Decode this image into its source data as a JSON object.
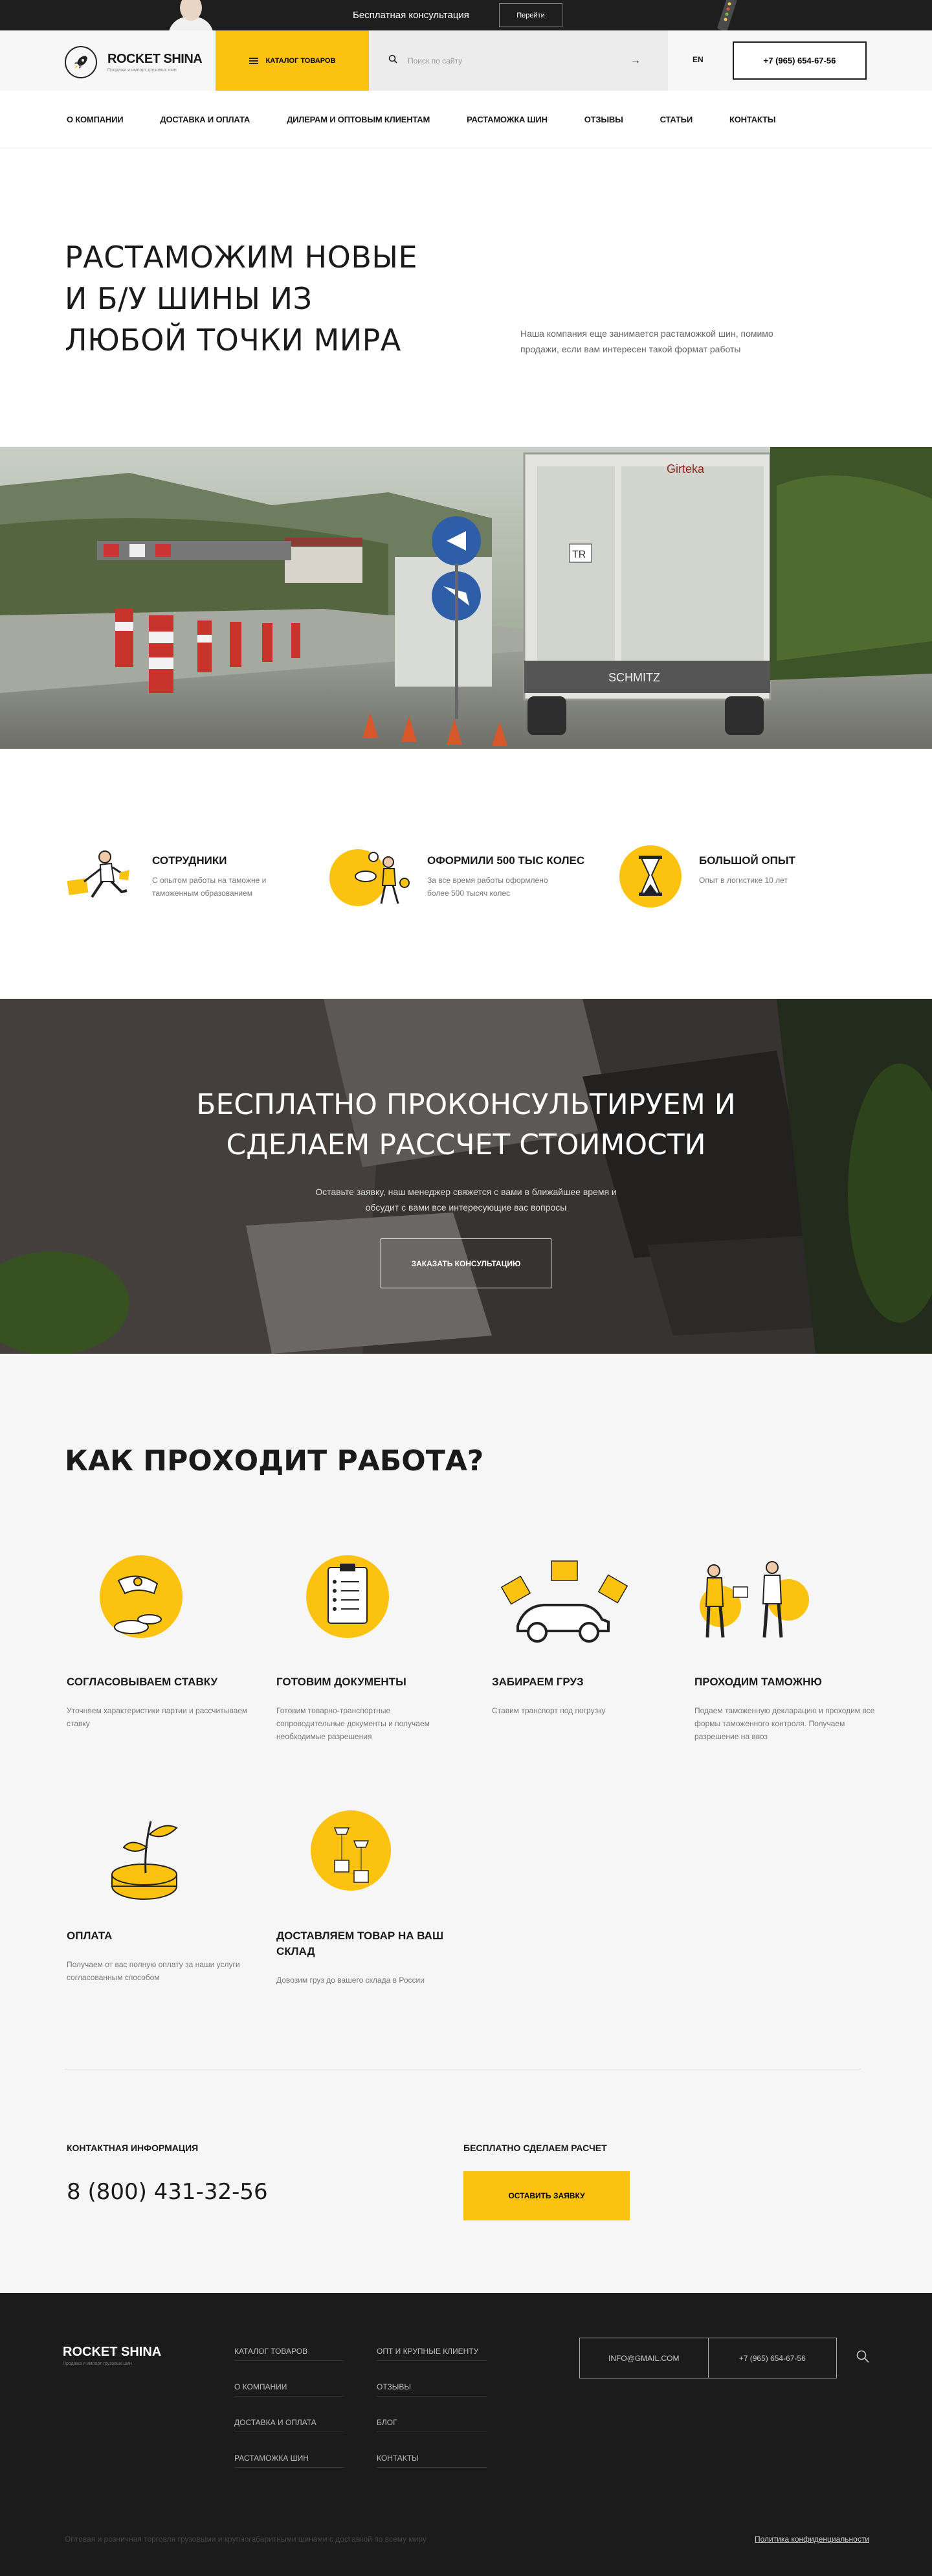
{
  "promo": {
    "text": "Бесплатная консультация",
    "button": "Перейти"
  },
  "header": {
    "logo_name": "ROCKET SHINA",
    "logo_sub": "Продажа и импорт грузовых шин",
    "catalog": "КАТАЛОГ ТОВАРОВ",
    "search_placeholder": "Поиск по сайту",
    "lang": "EN",
    "phone": "+7 (965) 654-67-56"
  },
  "nav": [
    "О КОМПАНИИ",
    "ДОСТАВКА И ОПЛАТА",
    "ДИЛЕРАМ И ОПТОВЫМ КЛИЕНТАМ",
    "РАСТАМОЖКА ШИН",
    "ОТЗЫВЫ",
    "СТАТЬИ",
    "КОНТАКТЫ"
  ],
  "hero": {
    "title": "РАСТАМОЖИМ НОВЫЕ И Б/У ШИНЫ ИЗ ЛЮБОЙ ТОЧКИ МИРА",
    "description": "Наша компания еще занимается растаможкой шин, помимо продажи, если вам интересен такой формат работы"
  },
  "photo": {
    "trailer_brand": "SCHMITZ",
    "plate": "TR",
    "company": "Girteka"
  },
  "stats": [
    {
      "title": "СОТРУДНИКИ",
      "desc": "С опытом работы на таможне и таможенным образованием"
    },
    {
      "title": "ОФОРМИЛИ 500 ТЫС КОЛЕС",
      "desc": "За все время работы оформлено более 500 тысяч колес"
    },
    {
      "title": "БОЛЬШОЙ ОПЫТ",
      "desc": "Опыт в логистике 10 лет"
    }
  ],
  "consult": {
    "title_line1": "БЕСПЛАТНО ПРОКОНСУЛЬТИРУЕМ И",
    "title_line2": "СДЕЛАЕМ РАССЧЕТ СТОИМОСТИ",
    "desc": "Оставьте заявку, наш менеджер свяжется с вами в ближайшее время и обсудит с вами все интересующие вас вопросы",
    "button": "ЗАКАЗАТЬ КОНСУЛЬТАЦИЮ"
  },
  "process": {
    "title": "КАК ПРОХОДИТ РАБОТА?",
    "steps": [
      {
        "title": "СОГЛАСОВЫВАЕМ СТАВКУ",
        "desc": "Уточняем характеристики партии и рассчитываем ставку"
      },
      {
        "title": "ГОТОВИМ ДОКУМЕНТЫ",
        "desc": "Готовим товарно-транспортные сопроводительные документы и получаем необходимые разрешения"
      },
      {
        "title": "ЗАБИРАЕМ ГРУЗ",
        "desc": "Ставим транспорт под погрузку"
      },
      {
        "title": "ПРОХОДИМ ТАМОЖНЮ",
        "desc": "Подаем таможенную декларацию и проходим все формы таможенного контроля. Получаем разрешение на ввоз"
      },
      {
        "title": "ОПЛАТА",
        "desc": "Получаем от вас полную оплату за наши услуги согласованным способом"
      },
      {
        "title": "ДОСТАВЛЯЕМ ТОВАР НА ВАШ СКЛАД",
        "desc": "Довозим груз до вашего склада в России"
      }
    ],
    "contact_label": "КОНТАКТНАЯ ИНФОРМАЦИЯ",
    "calc_label": "БЕСПЛАТНО СДЕЛАЕМ РАСЧЕТ",
    "big_phone": "8 (800) 431-32-56",
    "order_button": "ОСТАВИТЬ ЗАЯВКУ"
  },
  "footer": {
    "logo_name": "ROCKET SHINA",
    "logo_sub": "Продажа и импорт грузовых шин",
    "col1": [
      "КАТАЛОГ ТОВАРОВ",
      "О КОМПАНИИ",
      "ДОСТАВКА И ОПЛАТА",
      "РАСТАМОЖКА ШИН"
    ],
    "col2": [
      "ОПТ И КРУПНЫЕ КЛИЕНТУ",
      "ОТЗЫВЫ",
      "БЛОГ",
      "КОНТАКТЫ"
    ],
    "email": "INFO@GMAIL.COM",
    "phone": "+7 (965) 654-67-56",
    "bottom_text": "Оптовая и розничная торговля грузовыми и крупногабаритными шинами с доставкой по всему миру",
    "policy": "Политика конфиденциальности"
  },
  "colors": {
    "accent": "#fbc30f",
    "dark": "#1b1b1b",
    "light_bg": "#f6f6f6"
  }
}
